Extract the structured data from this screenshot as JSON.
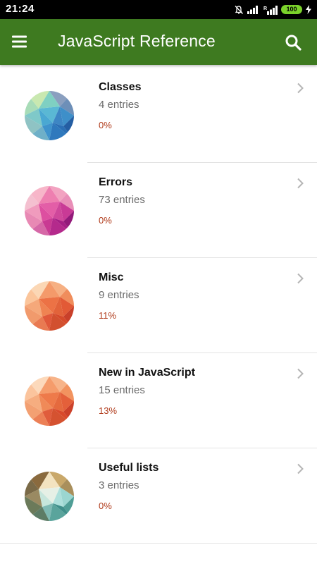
{
  "status_bar": {
    "time": "21:24",
    "battery": "100",
    "icons": [
      "mute-icon",
      "signal-icon",
      "signal-r-icon",
      "battery-icon",
      "charging-icon"
    ]
  },
  "app_bar": {
    "title": "JavaScript Reference",
    "color": "#3e7a20",
    "menu_icon": "hamburger-menu-icon",
    "search_icon": "search-icon"
  },
  "categories": [
    {
      "title": "Classes",
      "entries": "4 entries",
      "progress": "0%",
      "avatar_palette": [
        "#c9e8b0",
        "#7fd0c2",
        "#4aa8d2",
        "#2a6fb5",
        "#8a9fbf",
        "#3e8fc9"
      ]
    },
    {
      "title": "Errors",
      "entries": "73 entries",
      "progress": "0%",
      "avatar_palette": [
        "#f7b6c9",
        "#ee7fb0",
        "#dd4fa0",
        "#a61f85",
        "#e98fb8",
        "#c93a96"
      ]
    },
    {
      "title": "Misc",
      "entries": "9 entries",
      "progress": "11%",
      "avatar_palette": [
        "#fbc59b",
        "#f49a6a",
        "#ec7245",
        "#d64a2a",
        "#f6b083",
        "#e25a36"
      ]
    },
    {
      "title": "New in JavaScript",
      "entries": "15 entries",
      "progress": "13%",
      "avatar_palette": [
        "#fbc49d",
        "#f59c6b",
        "#ee7a4a",
        "#d9492b",
        "#f7b489",
        "#e4603a"
      ]
    },
    {
      "title": "Useful lists",
      "entries": "3 entries",
      "progress": "0%",
      "avatar_palette": [
        "#f3e3c0",
        "#d9c49a",
        "#9bd6d0",
        "#3f8f8a",
        "#8a7a52",
        "#c9a86a"
      ]
    }
  ],
  "accent": {
    "progress_color": "#b03a1a"
  }
}
